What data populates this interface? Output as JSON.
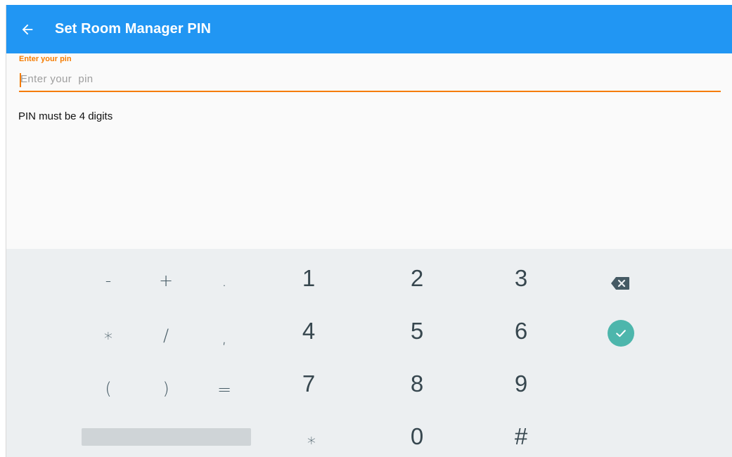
{
  "appbar": {
    "title": "Set Room Manager PIN",
    "back_icon": "arrow-back-icon",
    "background": "#2196f3"
  },
  "pin_field": {
    "label": "Enter your pin",
    "placeholder": "Enter your  pin",
    "value": "",
    "accent": "#f57c00"
  },
  "hint": "PIN must be 4 digits",
  "keyboard": {
    "row1": {
      "minus": "-",
      "plus": "+",
      "period": ".",
      "k1": "1",
      "k2": "2",
      "k3": "3"
    },
    "row2": {
      "asterisk": "∗",
      "slash": "/",
      "comma": ",",
      "k4": "4",
      "k5": "5",
      "k6": "6"
    },
    "row3": {
      "lparen": "(",
      "rparen": ")",
      "equals": "=",
      "k7": "7",
      "k8": "8",
      "k9": "9"
    },
    "row4": {
      "star": "∗",
      "k0": "0",
      "hash": "#"
    },
    "backspace_icon": "backspace-icon",
    "done_icon": "check-circle-icon",
    "done_color": "#4db6ac",
    "background": "#eceff1"
  }
}
